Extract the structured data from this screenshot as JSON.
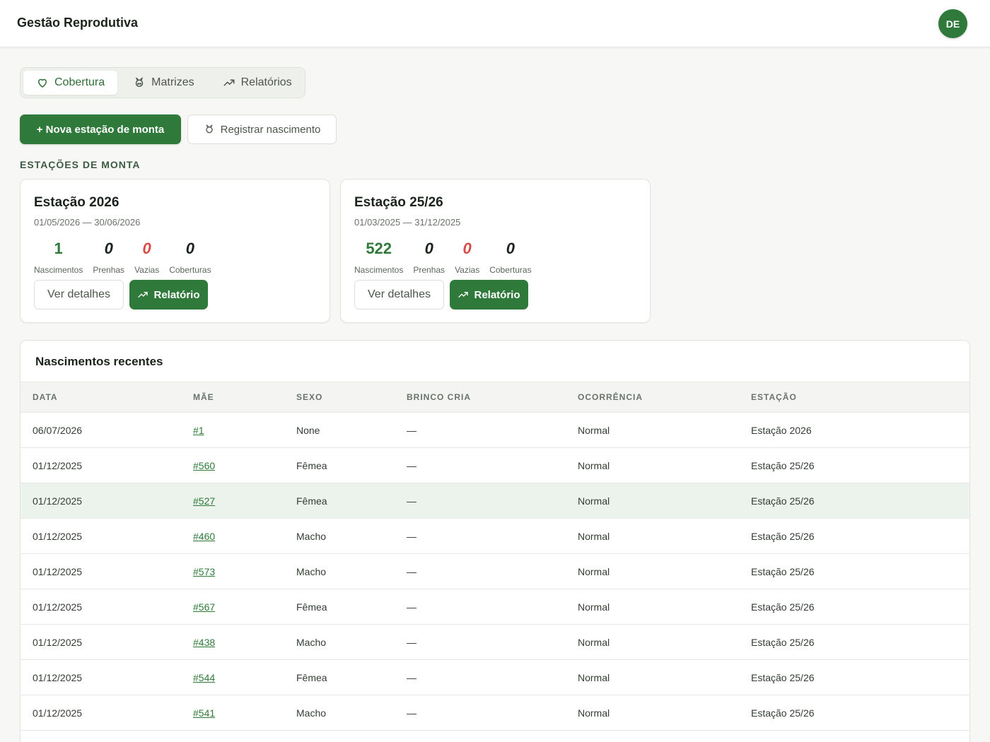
{
  "header": {
    "title": "Gestão Reprodutiva",
    "avatar_initials": "DE"
  },
  "tabs": [
    {
      "label": "Cobertura",
      "icon": "heart-icon",
      "active": true
    },
    {
      "label": "Matrizes",
      "icon": "pig-icon",
      "active": false
    },
    {
      "label": "Relatórios",
      "icon": "trending-up-icon",
      "active": false
    }
  ],
  "actions": {
    "new_station_label": "+ Nova estação de monta",
    "register_birth_label": "Registrar nascimento"
  },
  "section_label": "ESTAÇÕES DE MONTA",
  "stations": [
    {
      "title": "Estação 2026",
      "dates": "01/05/2026 — 30/06/2026",
      "stats": [
        {
          "value": "1",
          "label": "Nascimentos"
        },
        {
          "value": "0",
          "label": "Prenhas"
        },
        {
          "value": "0",
          "label": "Vazias"
        },
        {
          "value": "0",
          "label": "Coberturas"
        }
      ],
      "details_label": "Ver detalhes",
      "report_label": "Relatório"
    },
    {
      "title": "Estação 25/26",
      "dates": "01/03/2025 — 31/12/2025",
      "stats": [
        {
          "value": "522",
          "label": "Nascimentos"
        },
        {
          "value": "0",
          "label": "Prenhas"
        },
        {
          "value": "0",
          "label": "Vazias"
        },
        {
          "value": "0",
          "label": "Coberturas"
        }
      ],
      "details_label": "Ver detalhes",
      "report_label": "Relatório"
    }
  ],
  "births": {
    "title": "Nascimentos recentes",
    "columns": [
      "DATA",
      "MÃE",
      "SEXO",
      "BRINCO CRIA",
      "OCORRÊNCIA",
      "ESTAÇÃO"
    ],
    "rows": [
      {
        "data": "06/07/2026",
        "mae": "#1",
        "sexo": "None",
        "brinco": "—",
        "ocorrencia": "Normal",
        "estacao": "Estação 2026"
      },
      {
        "data": "01/12/2025",
        "mae": "#560",
        "sexo": "Fêmea",
        "brinco": "—",
        "ocorrencia": "Normal",
        "estacao": "Estação 25/26"
      },
      {
        "data": "01/12/2025",
        "mae": "#527",
        "sexo": "Fêmea",
        "brinco": "—",
        "ocorrencia": "Normal",
        "estacao": "Estação 25/26"
      },
      {
        "data": "01/12/2025",
        "mae": "#460",
        "sexo": "Macho",
        "brinco": "—",
        "ocorrencia": "Normal",
        "estacao": "Estação 25/26"
      },
      {
        "data": "01/12/2025",
        "mae": "#573",
        "sexo": "Macho",
        "brinco": "—",
        "ocorrencia": "Normal",
        "estacao": "Estação 25/26"
      },
      {
        "data": "01/12/2025",
        "mae": "#567",
        "sexo": "Fêmea",
        "brinco": "—",
        "ocorrencia": "Normal",
        "estacao": "Estação 25/26"
      },
      {
        "data": "01/12/2025",
        "mae": "#438",
        "sexo": "Macho",
        "brinco": "—",
        "ocorrencia": "Normal",
        "estacao": "Estação 25/26"
      },
      {
        "data": "01/12/2025",
        "mae": "#544",
        "sexo": "Fêmea",
        "brinco": "—",
        "ocorrencia": "Normal",
        "estacao": "Estação 25/26"
      },
      {
        "data": "01/12/2025",
        "mae": "#541",
        "sexo": "Macho",
        "brinco": "—",
        "ocorrencia": "Normal",
        "estacao": "Estação 25/26"
      }
    ]
  },
  "colors": {
    "accent": "#2f7a3a",
    "danger": "#d94b45",
    "row_highlight": "#ecf3ec"
  }
}
